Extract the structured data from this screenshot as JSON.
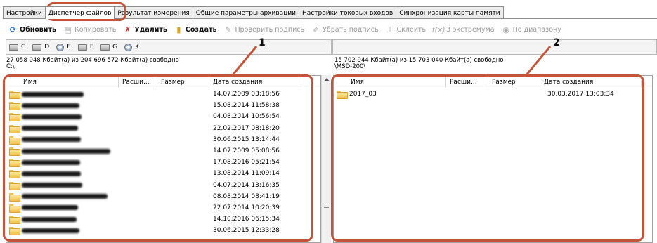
{
  "tabs": [
    {
      "label": "Настройки"
    },
    {
      "label": "Диспетчер файлов"
    },
    {
      "label": "Результат измерения"
    },
    {
      "label": "Общие параметры архивации"
    },
    {
      "label": "Настройки токовых входов"
    },
    {
      "label": "Синхронизация карты памяти"
    }
  ],
  "toolbar": {
    "refresh": "Обновить",
    "copy": "Копировать",
    "delete": "Удалить",
    "create": "Создать",
    "verify_sign": "Проверить подпись",
    "remove_sign": "Убрать подпись",
    "merge": "Склеить",
    "extremum": "3 экстремума",
    "by_range": "По диапазону"
  },
  "left": {
    "drives": [
      "C",
      "D",
      "E",
      "F",
      "G",
      "K"
    ],
    "free_space": "27 058 048 Кбайт(а) из 204 696 572 Кбайт(а) свободно",
    "path": "C:\\",
    "columns": {
      "name": "Имя",
      "ext": "Расши...",
      "size": "Размер",
      "date": "Дата создания"
    },
    "rows": [
      {
        "date": "14.07.2009 03:18:56"
      },
      {
        "date": "15.08.2014 11:58:38"
      },
      {
        "date": "04.08.2014 10:56:54"
      },
      {
        "date": "22.02.2017 08:18:20"
      },
      {
        "date": "30.06.2015 13:14:44"
      },
      {
        "date": "14.07.2009 05:08:56"
      },
      {
        "date": "17.08.2016 05:21:54"
      },
      {
        "date": "13.08.2014 11:09:14"
      },
      {
        "date": "04.07.2014 13:16:35"
      },
      {
        "date": "08.08.2014 08:41:19"
      },
      {
        "date": "22.07.2014 10:20:39"
      },
      {
        "date": "14.10.2016 06:15:34"
      },
      {
        "date": "30.06.2015 12:33:28"
      }
    ]
  },
  "right": {
    "free_space": "15 702 944 Кбайт(а) из 15 703 040 Кбайт(а) свободно",
    "path": "\\MSD-200\\",
    "columns": {
      "name": "Имя",
      "ext": "Расши...",
      "size": "Размер",
      "date": "Дата создания"
    },
    "rows": [
      {
        "name": "2017_03",
        "date": "30.03.2017 13:03:34"
      }
    ]
  },
  "annotations": {
    "label_1": "1",
    "label_2": "2",
    "color": "#c4533a"
  }
}
